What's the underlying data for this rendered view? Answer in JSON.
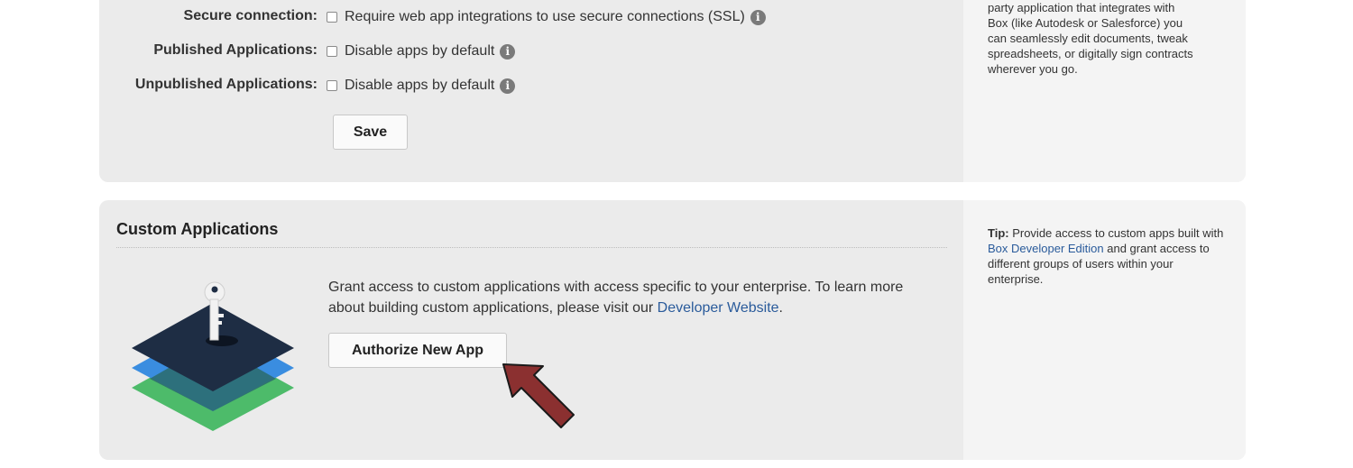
{
  "settings": {
    "secure_connection": {
      "label": "Secure connection:",
      "option": "Require web app integrations to use secure connections (SSL)"
    },
    "published_apps": {
      "label": "Published Applications:",
      "option": "Disable apps by default"
    },
    "unpublished_apps": {
      "label": "Unpublished Applications:",
      "option": "Disable apps by default"
    },
    "save_label": "Save",
    "info_glyph": "i"
  },
  "side_panel_1": {
    "lines": [
      "party application that integrates with",
      "Box (like Autodesk or Salesforce) you",
      "can seamlessly edit documents, tweak",
      "spreadsheets, or digitally sign contracts",
      "wherever you go."
    ]
  },
  "custom_apps": {
    "title": "Custom Applications",
    "description_prefix": "Grant access to custom applications with access specific to your enterprise. To learn more about building custom applications, please visit our ",
    "description_link": "Developer Website",
    "description_suffix": ".",
    "authorize_label": "Authorize New App"
  },
  "side_panel_2": {
    "tip_label": "Tip:",
    "tip_prefix": " Provide access to custom apps built with ",
    "tip_link": "Box Developer Edition",
    "tip_suffix": " and grant access to different groups of users within your enterprise."
  },
  "colors": {
    "arrow": "#8b3030",
    "layer_dark": "#1e2d44",
    "layer_blue": "#3a8de0",
    "layer_green": "#4dbb6a"
  }
}
